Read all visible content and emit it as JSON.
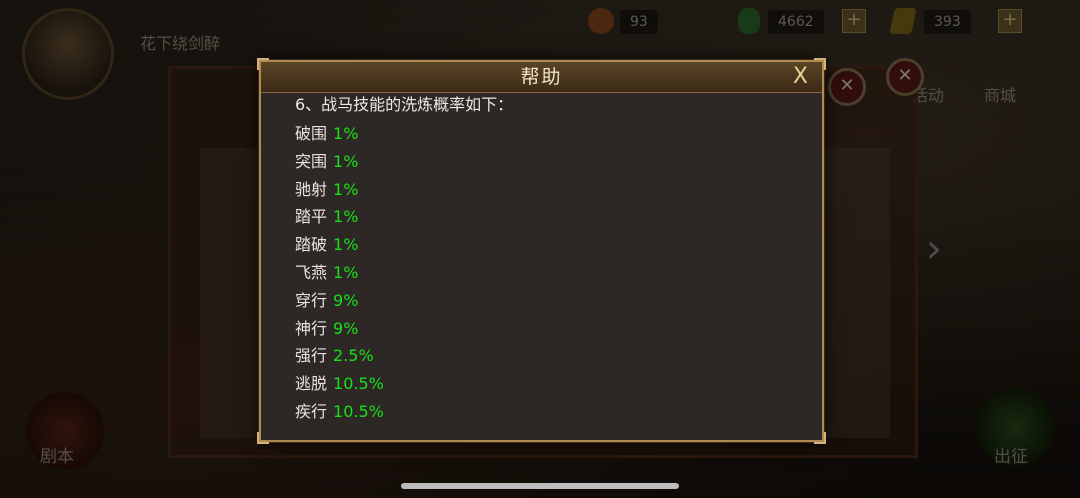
{
  "background": {
    "player_name": "花下绕剑醉",
    "resources": [
      {
        "icon": "gold-ingot-icon",
        "value": "93"
      },
      {
        "icon": "jade-icon",
        "value": "4662"
      },
      {
        "icon": "token-icon",
        "value": "393"
      }
    ],
    "side_buttons": {
      "activity": "活动",
      "shop": "商城"
    },
    "bottom_left_button": "剧本",
    "bottom_right_button": "出征"
  },
  "dialog": {
    "title": "帮助",
    "close_label": "X",
    "intro": "6、战马技能的洗炼概率如下：",
    "skills": [
      {
        "name": "破围",
        "rate": "1%"
      },
      {
        "name": "突围",
        "rate": "1%"
      },
      {
        "name": "驰射",
        "rate": "1%"
      },
      {
        "name": "踏平",
        "rate": "1%"
      },
      {
        "name": "踏破",
        "rate": "1%"
      },
      {
        "name": "飞燕",
        "rate": "1%"
      },
      {
        "name": "穿行",
        "rate": "9%"
      },
      {
        "name": "神行",
        "rate": "9%"
      },
      {
        "name": "强行",
        "rate": "2.5%"
      },
      {
        "name": "逃脱",
        "rate": "10.5%"
      },
      {
        "name": "疾行",
        "rate": "10.5%"
      }
    ]
  },
  "colors": {
    "rate": "#18e018",
    "dialog_border": "#b08a53",
    "title": "#f3e4c4"
  }
}
